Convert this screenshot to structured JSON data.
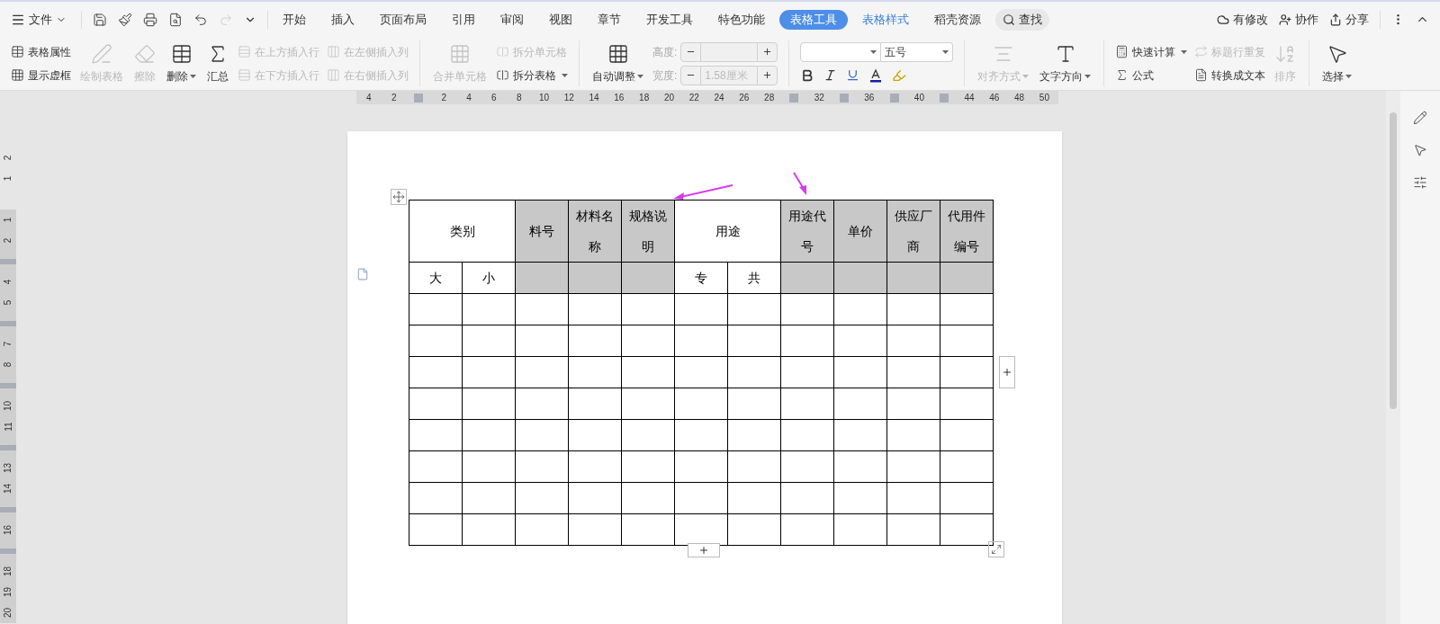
{
  "menu_bar": {
    "file_menu": "文件",
    "tabs": [
      {
        "label": "开始",
        "selected": false,
        "contextual": false
      },
      {
        "label": "插入",
        "selected": false,
        "contextual": false
      },
      {
        "label": "页面布局",
        "selected": false,
        "contextual": false
      },
      {
        "label": "引用",
        "selected": false,
        "contextual": false
      },
      {
        "label": "审阅",
        "selected": false,
        "contextual": false
      },
      {
        "label": "视图",
        "selected": false,
        "contextual": false
      },
      {
        "label": "章节",
        "selected": false,
        "contextual": false
      },
      {
        "label": "开发工具",
        "selected": false,
        "contextual": false
      },
      {
        "label": "特色功能",
        "selected": false,
        "contextual": false
      },
      {
        "label": "表格工具",
        "selected": true,
        "contextual": true
      },
      {
        "label": "表格样式",
        "selected": false,
        "contextual": true
      },
      {
        "label": "稻壳资源",
        "selected": false,
        "contextual": false
      }
    ],
    "search": "查找",
    "actions": [
      {
        "label": "有修改",
        "kind": "cloud"
      },
      {
        "label": "协作",
        "kind": "user"
      },
      {
        "label": "分享",
        "kind": "share"
      }
    ]
  },
  "ribbon": [
    {
      "kind": "stack",
      "items": [
        {
          "label": "表格属性",
          "disabled": false,
          "dropdown": false
        },
        {
          "label": "显示虚框",
          "disabled": false,
          "dropdown": false
        }
      ]
    },
    {
      "kind": "large",
      "label": "绘制表格",
      "disabled": true,
      "dropdown": false
    },
    {
      "kind": "large",
      "label": "擦除",
      "disabled": true,
      "dropdown": false
    },
    {
      "kind": "large",
      "label": "删除",
      "disabled": false,
      "dropdown": true
    },
    {
      "kind": "large",
      "label": "汇总",
      "disabled": false,
      "dropdown": false
    },
    {
      "kind": "stack",
      "items": [
        {
          "label": "在上方插入行",
          "disabled": true,
          "dropdown": false
        },
        {
          "label": "在下方插入行",
          "disabled": true,
          "dropdown": false
        }
      ]
    },
    {
      "kind": "stack",
      "items": [
        {
          "label": "在左侧插入列",
          "disabled": true,
          "dropdown": false
        },
        {
          "label": "在右侧插入列",
          "disabled": true,
          "dropdown": false
        }
      ]
    },
    {
      "kind": "separator"
    },
    {
      "kind": "large",
      "label": "合并单元格",
      "disabled": true,
      "dropdown": false
    },
    {
      "kind": "stack",
      "items": [
        {
          "label": "拆分单元格",
          "disabled": true,
          "dropdown": false
        },
        {
          "label": "拆分表格",
          "disabled": false,
          "dropdown": true
        }
      ]
    },
    {
      "kind": "separator"
    },
    {
      "kind": "large",
      "label": "自动调整",
      "disabled": false,
      "dropdown": true
    },
    {
      "kind": "spinners",
      "items": [
        {
          "label": "高度:",
          "disabled": true
        },
        {
          "label": "宽度:",
          "value": "1.58厘米",
          "disabled": true
        }
      ]
    },
    {
      "kind": "separator"
    },
    {
      "kind": "font",
      "font_size": "五号"
    },
    {
      "kind": "separator"
    },
    {
      "kind": "large",
      "label": "对齐方式",
      "disabled": true,
      "dropdown": true
    },
    {
      "kind": "large",
      "label": "文字方向",
      "disabled": false,
      "dropdown": true
    },
    {
      "kind": "separator"
    },
    {
      "kind": "stack",
      "items": [
        {
          "label": "快速计算",
          "disabled": false,
          "dropdown": true
        },
        {
          "label": "公式",
          "disabled": false,
          "dropdown": false
        }
      ]
    },
    {
      "kind": "stack",
      "items": [
        {
          "label": "标题行重复",
          "disabled": true,
          "dropdown": false
        },
        {
          "label": "转换成文本",
          "disabled": false,
          "dropdown": false
        }
      ]
    },
    {
      "kind": "large",
      "label": "排序",
      "disabled": true,
      "dropdown": false
    },
    {
      "kind": "separator"
    },
    {
      "kind": "large",
      "label": "选择",
      "disabled": false,
      "dropdown": true
    }
  ],
  "horizontal_ruler": [
    {
      "kind": "number",
      "text": "4"
    },
    {
      "kind": "number",
      "text": "2"
    },
    {
      "kind": "marker"
    },
    {
      "kind": "number",
      "text": "2"
    },
    {
      "kind": "number",
      "text": "4"
    },
    {
      "kind": "number",
      "text": "6"
    },
    {
      "kind": "number",
      "text": "8"
    },
    {
      "kind": "number",
      "text": "10"
    },
    {
      "kind": "number",
      "text": "12"
    },
    {
      "kind": "number",
      "text": "14"
    },
    {
      "kind": "number",
      "text": "16"
    },
    {
      "kind": "number",
      "text": "18"
    },
    {
      "kind": "number",
      "text": "20"
    },
    {
      "kind": "number",
      "text": "22"
    },
    {
      "kind": "number",
      "text": "24"
    },
    {
      "kind": "number",
      "text": "26"
    },
    {
      "kind": "number",
      "text": "28"
    },
    {
      "kind": "marker"
    },
    {
      "kind": "number",
      "text": "32"
    },
    {
      "kind": "marker"
    },
    {
      "kind": "number",
      "text": "36"
    },
    {
      "kind": "marker"
    },
    {
      "kind": "number",
      "text": "40"
    },
    {
      "kind": "marker"
    },
    {
      "kind": "number",
      "text": "44"
    },
    {
      "kind": "number",
      "text": "46"
    },
    {
      "kind": "number",
      "text": "48"
    },
    {
      "kind": "number",
      "text": "50"
    }
  ],
  "vertical_ruler": [
    {
      "kind": "number",
      "text": "2"
    },
    {
      "kind": "number",
      "text": "1"
    },
    {
      "kind": "blank"
    },
    {
      "kind": "number",
      "text": "1"
    },
    {
      "kind": "number",
      "text": "2"
    },
    {
      "kind": "marker"
    },
    {
      "kind": "number",
      "text": "4"
    },
    {
      "kind": "number",
      "text": "5"
    },
    {
      "kind": "marker"
    },
    {
      "kind": "number",
      "text": "7"
    },
    {
      "kind": "number",
      "text": "8"
    },
    {
      "kind": "marker"
    },
    {
      "kind": "number",
      "text": "10"
    },
    {
      "kind": "number",
      "text": "11"
    },
    {
      "kind": "marker"
    },
    {
      "kind": "number",
      "text": "13"
    },
    {
      "kind": "number",
      "text": "14"
    },
    {
      "kind": "marker"
    },
    {
      "kind": "number",
      "text": "16"
    },
    {
      "kind": "marker"
    },
    {
      "kind": "number",
      "text": "18"
    },
    {
      "kind": "number",
      "text": "19"
    },
    {
      "kind": "number",
      "text": "20"
    }
  ],
  "table": {
    "header": [
      {
        "text": "类别",
        "kind": "merged",
        "shaded": false
      },
      {
        "text": "料号",
        "kind": "single",
        "shaded": true
      },
      {
        "text": "材料名称",
        "kind": "single",
        "shaded": true
      },
      {
        "text": "规格说明",
        "kind": "single",
        "shaded": true
      },
      {
        "text": "用途",
        "kind": "merged",
        "shaded": false
      },
      {
        "text": "用途代号",
        "kind": "single",
        "shaded": true
      },
      {
        "text": "单价",
        "kind": "single",
        "shaded": true
      },
      {
        "text": "供应厂商",
        "kind": "single",
        "shaded": true
      },
      {
        "text": "代用件编号",
        "kind": "single",
        "shaded": true
      }
    ],
    "subheader": [
      {
        "text": "大",
        "shaded": false
      },
      {
        "text": "小",
        "shaded": false
      },
      {
        "shaded": true
      },
      {
        "shaded": true
      },
      {
        "shaded": true
      },
      {
        "text": "专",
        "shaded": false
      },
      {
        "text": "共",
        "shaded": false
      },
      {
        "shaded": true
      },
      {
        "shaded": true
      },
      {
        "shaded": true
      },
      {
        "shaded": true
      }
    ]
  }
}
